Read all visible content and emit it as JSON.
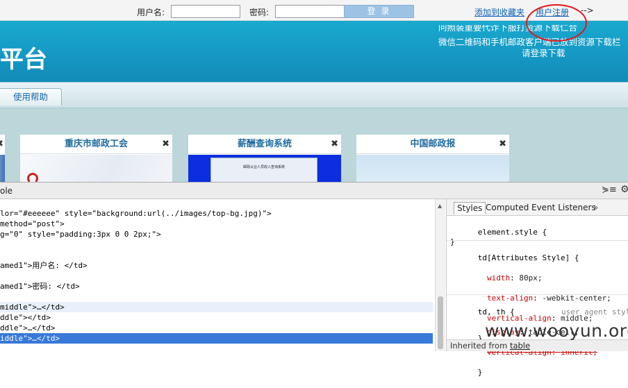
{
  "topbar": {
    "username_label": "用户名:",
    "username_value": "",
    "password_label": "密码:",
    "password_value": "",
    "login_button": "登 录",
    "add_favorite": "添加到收藏夹",
    "register": "用户注册",
    "arrow": "-->"
  },
  "banner": {
    "title_fragment": "平台",
    "notice_lines": [
      "问照装重要代诈下服打资源下载仁合",
      "微信二维码和手机邮政客户端已放到资源下载栏",
      "请登录下载"
    ]
  },
  "nav": {
    "help_tab": "使用帮助"
  },
  "cards": [
    {
      "title": "重庆市邮政工会",
      "close": "✖"
    },
    {
      "title": "薪酬查询系统",
      "close": "✖",
      "preview_text": "邮政从业人员收入查询系统"
    },
    {
      "title": "中国邮政报",
      "close": "✖"
    }
  ],
  "devtools": {
    "tab": "ole",
    "element_lines": [
      "lor=\"#eeeeee\" style=\"background:url(../images/top-bg.jpg)\">",
      "method=\"post\">",
      "g=\"0\" style=\"padding:3px 0 0 2px;\">",
      "",
      "amed1\">用户名: </td>",
      "",
      "amed1\">密码: </td>",
      "",
      "middle\">…</td>",
      "ddle\"></td>",
      "ddle\">…</td>",
      "iddle\">…</td>"
    ],
    "styles_panel": {
      "tabs": [
        "Styles",
        "Computed",
        "Event Listeners",
        "»"
      ],
      "element_style": "element.style {",
      "attr_selector": "td[Attributes Style] {",
      "attr_props": [
        {
          "name": "width",
          "value": "80px;"
        },
        {
          "name": "text-align",
          "value": "-webkit-center;"
        },
        {
          "name": "vertical-align",
          "value": "middle;"
        }
      ],
      "ua_selector": "td, th {",
      "ua_label": "user agent styl",
      "ua_props": [
        {
          "name": "display",
          "value": "table-cell;"
        },
        {
          "name": "vertical-align",
          "value": "inherit;"
        }
      ],
      "inherited_label": "Inherited from",
      "inherited_link": "table"
    }
  },
  "watermark": "www.wooyun.org",
  "colors": {
    "banner": "#1597c3",
    "annotation_circle": "#e01818",
    "selection": "#3879d9"
  }
}
